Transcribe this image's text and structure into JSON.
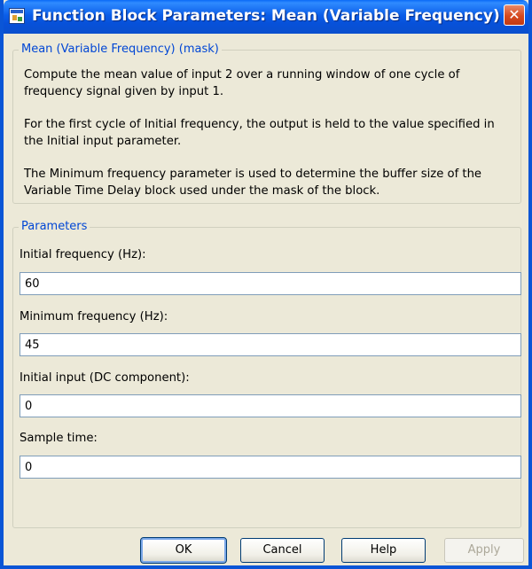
{
  "window": {
    "title": "Function Block Parameters: Mean (Variable Frequency)"
  },
  "description": {
    "legend": "Mean (Variable Frequency) (mask)",
    "paragraphs": [
      "Compute the mean value of input 2 over a running window of one cycle of frequency signal given by input 1.",
      "For the first cycle of Initial frequency, the output is held to the value specified in the Initial input parameter.",
      "The Minimum frequency parameter is used to determine the buffer size of the Variable Time Delay block used under the mask of the block."
    ]
  },
  "parameters": {
    "legend": "Parameters",
    "fields": [
      {
        "label": "Initial frequency (Hz):",
        "value": "60"
      },
      {
        "label": "Minimum frequency (Hz):",
        "value": "45"
      },
      {
        "label": "Initial input (DC component):",
        "value": "0"
      },
      {
        "label": "Sample time:",
        "value": "0"
      }
    ]
  },
  "buttons": {
    "ok": "OK",
    "cancel": "Cancel",
    "help": "Help",
    "apply": "Apply"
  },
  "colors": {
    "titlebar": "#0a5ee9",
    "legend": "#0046d5",
    "close": "#d6491e",
    "background": "#ece9d8"
  }
}
